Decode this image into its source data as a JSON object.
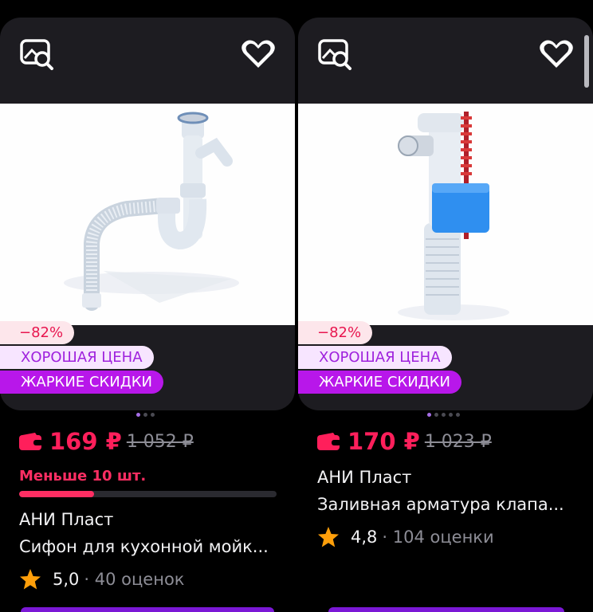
{
  "products": [
    {
      "discount": "−82%",
      "badge_good": "ХОРОШАЯ ЦЕНА",
      "badge_hot": "ЖАРКИЕ СКИДКИ",
      "price": "169 ₽",
      "old_price": "1 052 ₽",
      "stock_label": "Меньше 10 шт.",
      "stock_fraction": 0.29,
      "brand": "АНИ Пласт",
      "name": "Сифон для кухонной мойк...",
      "rating": "5,0",
      "reviews": "· 40 оценок",
      "dots": 3,
      "active_dot": 0
    },
    {
      "discount": "−82%",
      "badge_good": "ХОРОШАЯ ЦЕНА",
      "badge_hot": "ЖАРКИЕ СКИДКИ",
      "price": "170 ₽",
      "old_price": "1 023 ₽",
      "brand": "АНИ Пласт",
      "name": "Заливная арматура клапа...",
      "rating": "4,8",
      "reviews": "· 104 оценки",
      "dots": 5,
      "active_dot": 0
    }
  ],
  "icons": [
    "image-search-icon",
    "heart-icon",
    "wallet-icon",
    "star-icon"
  ],
  "colors": {
    "price": "#ff1f5b",
    "accent": "#b817ea",
    "star": "#ff9f0a"
  }
}
